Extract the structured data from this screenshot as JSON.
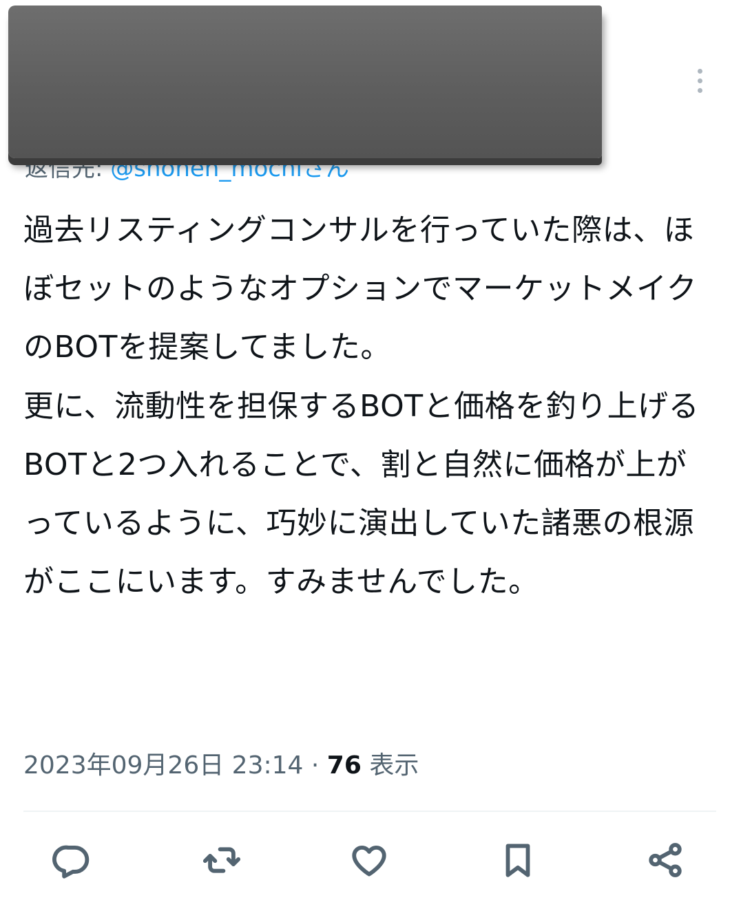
{
  "reply": {
    "prefix": "返信先: ",
    "handle": "@shonen_mochi",
    "suffix": "さん"
  },
  "tweet": {
    "text": "過去リスティングコンサルを行っていた際は、ほぼセットのようなオプションでマーケットメイクのBOTを提案してました。\n更に、流動性を担保するBOTと価格を釣り上げるBOTと2つ入れることで、割と自然に価格が上がっているように、巧妙に演出していた諸悪の根源がここにいます。すみませんでした。",
    "timestamp": "2023年09月26日 23:14",
    "separator": " · ",
    "views_count": "76",
    "views_label": " 表示"
  },
  "icons": {
    "more": "more-vertical-icon",
    "reply": "reply-icon",
    "retweet": "retweet-icon",
    "like": "heart-icon",
    "bookmark": "bookmark-icon",
    "share": "share-icon"
  },
  "colors": {
    "text": "#0f1419",
    "secondary": "#536471",
    "link": "#1d9bf0",
    "redaction": "#5e5e5e"
  }
}
